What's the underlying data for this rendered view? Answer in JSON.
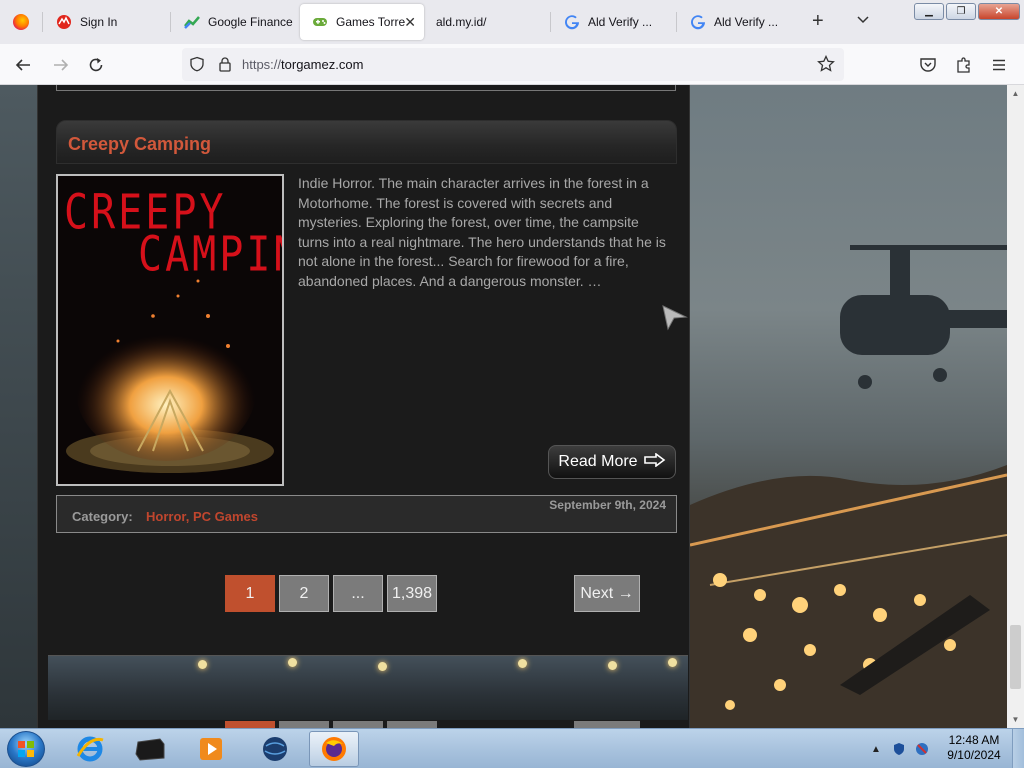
{
  "browser": {
    "tabs": [
      {
        "label": "Sign In",
        "icon": "red-bird-icon"
      },
      {
        "label": "Google Finance",
        "icon": "finance-chart-icon"
      },
      {
        "label": "Games Torre",
        "icon": "gamepad-icon",
        "active": true
      },
      {
        "label": "ald.my.id/",
        "icon": ""
      },
      {
        "label": "Ald Verify ...",
        "icon": "google-g-icon"
      },
      {
        "label": "Ald Verify ...",
        "icon": "google-g-icon"
      }
    ],
    "url_scheme": "https://",
    "url_host": "torgamez.com"
  },
  "post": {
    "title": "Creepy Camping",
    "cover_word1": "CREEPY",
    "cover_word2": "CAMPING",
    "excerpt": "Indie Horror. The main character arrives in the forest in a Motorhome. The forest is covered with secrets and mysteries. Exploring the forest, over time, the campsite turns into a real nightmare. The hero understands that he is not alone in the forest... Search for firewood for a fire, abandoned places. And a dangerous monster. …",
    "read_more": "Read More",
    "date": "September 9th, 2024",
    "category_label": "Category:",
    "categories": "Horror, PC Games"
  },
  "pagination": {
    "pages": [
      "1",
      "2",
      "...",
      "1,398"
    ],
    "current": "1",
    "next": "Next →"
  },
  "taskbar": {
    "time": "12:48 AM",
    "date": "9/10/2024"
  },
  "colors": {
    "accent": "#c0502e",
    "title": "#d2583b",
    "link": "#c0462e"
  }
}
